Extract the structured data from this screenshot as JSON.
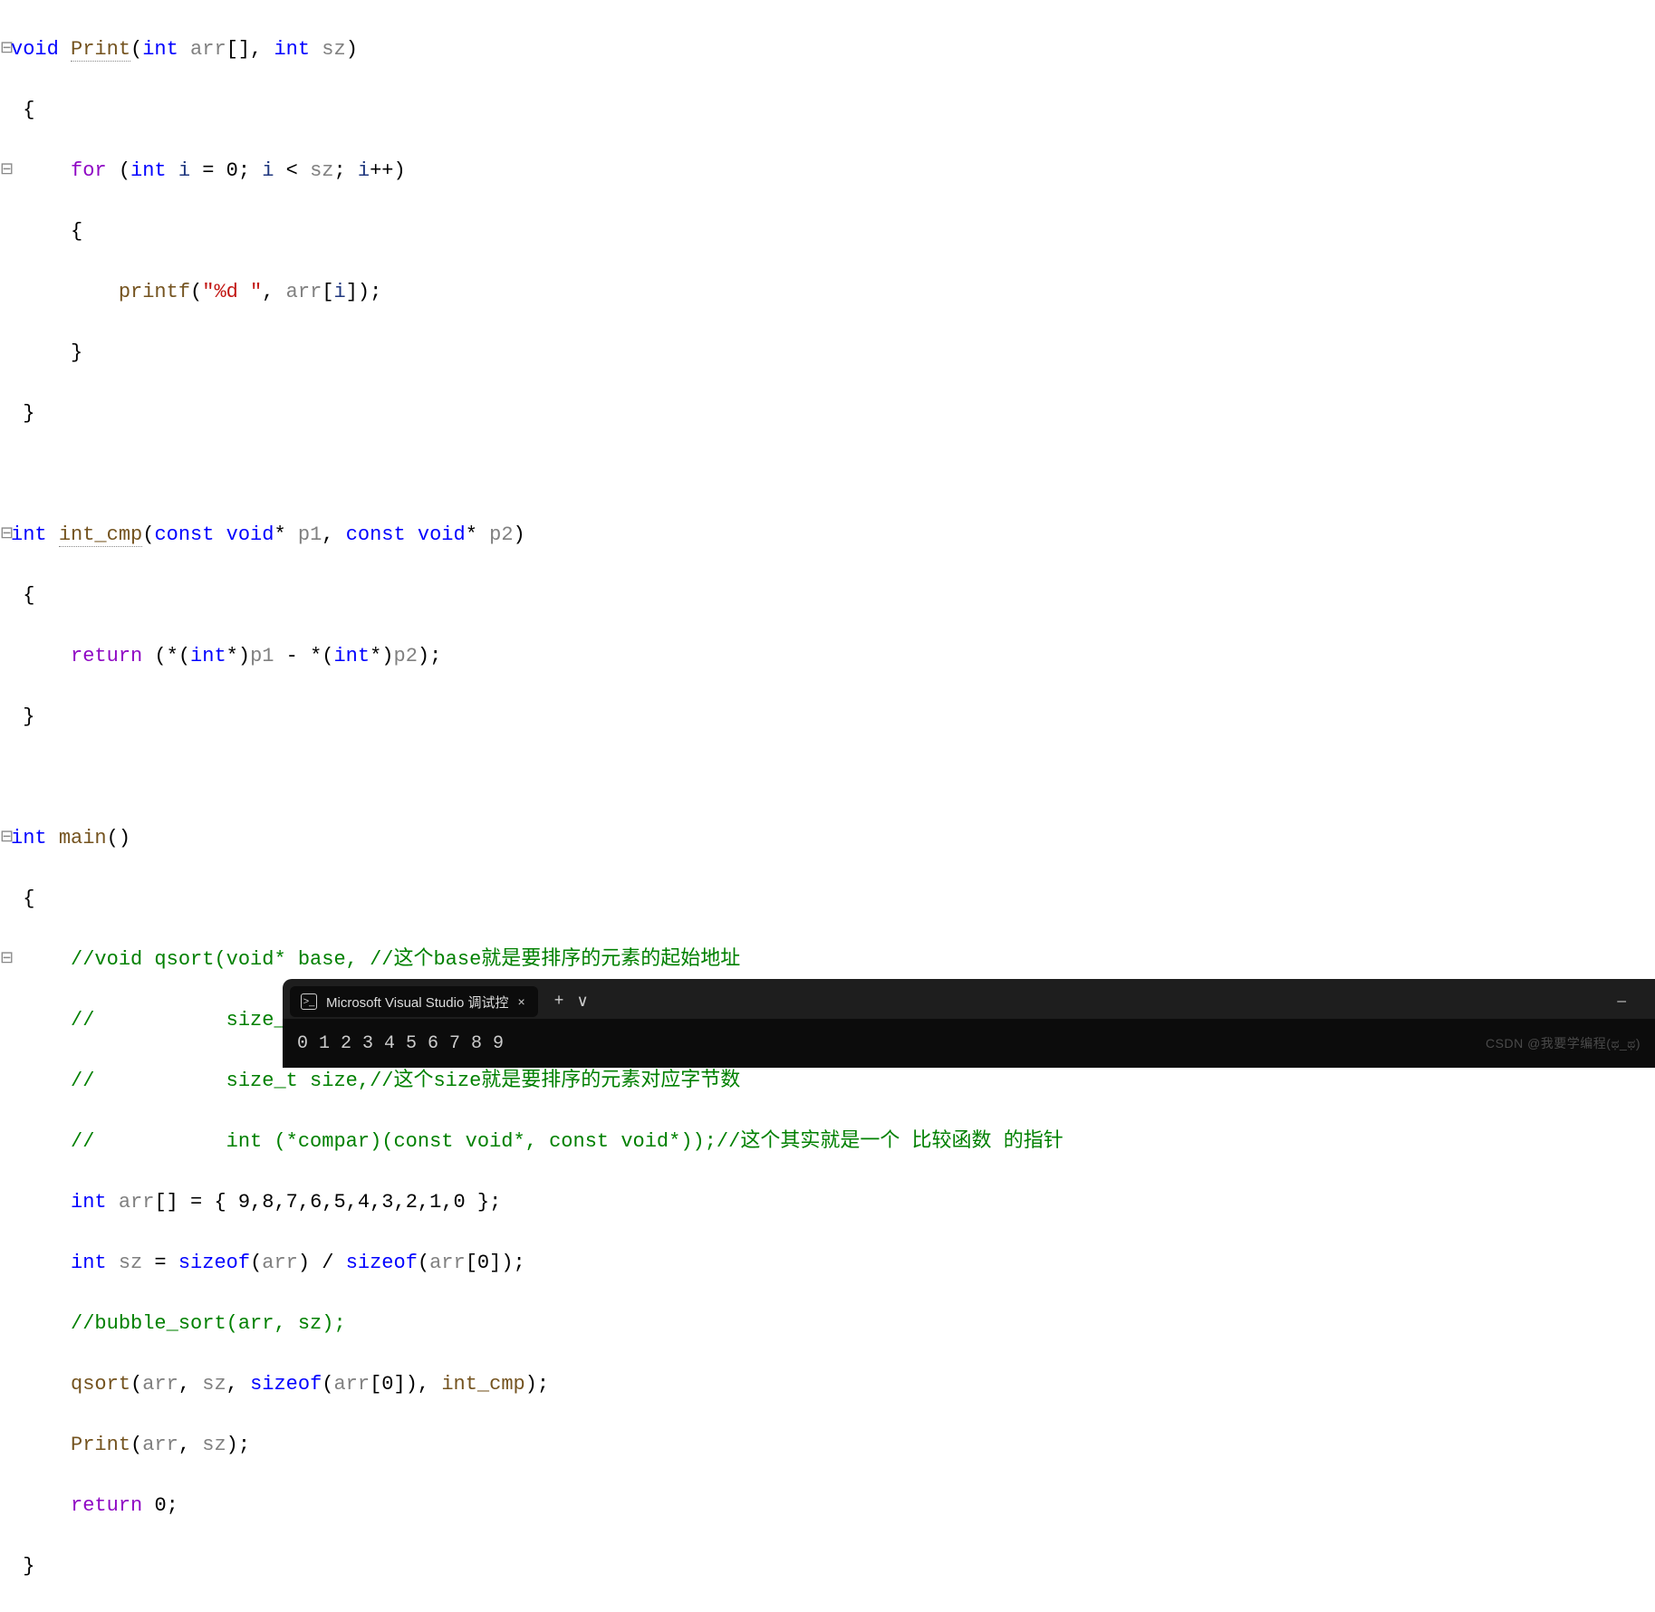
{
  "code": {
    "l1": {
      "void": "void",
      "print": "Print",
      "int": "int",
      "arr": "arr",
      "sz": "sz"
    },
    "l2": "{",
    "l3": {
      "for": "for",
      "int": "int",
      "i": "i",
      "eq": " = ",
      "zero": "0",
      "semi": "; ",
      "lt": " < ",
      "sz": "sz",
      "inc": "i++"
    },
    "l4": "{",
    "l5": {
      "printf": "printf",
      "fmt": "\"%d \"",
      "arr": "arr",
      "i": "i"
    },
    "l6": "}",
    "l7": "}",
    "l8": {
      "int": "int",
      "name": "int_cmp",
      "const": "const",
      "void": "void",
      "p1": "p1",
      "p2": "p2"
    },
    "l9": "{",
    "l10": {
      "return": "return",
      "int": "int",
      "p1": "p1",
      "p2": "p2"
    },
    "l11": "}",
    "l12": {
      "int": "int",
      "main": "main"
    },
    "l13": "{",
    "c1": "//void qsort(void* base, //这个base就是要排序的元素的起始地址",
    "c2": "//           size_t num, //这个num就是要排序的元素个数",
    "c3": "//           size_t size,//这个size就是要排序的元素对应字节数",
    "c4": "//           int (*compar)(const void*, const void*));//这个其实就是一个 比较函数 的指针",
    "l14": {
      "int": "int",
      "arr": "arr",
      "vals": "9,8,7,6,5,4,3,2,1,0"
    },
    "l15": {
      "int": "int",
      "sz": "sz",
      "sizeof": "sizeof",
      "arr": "arr",
      "zero": "0"
    },
    "c5": "//bubble_sort(arr, sz);",
    "l16": {
      "qsort": "qsort",
      "arr": "arr",
      "sz": "sz",
      "sizeof": "sizeof",
      "zero": "0",
      "cmp": "int_cmp"
    },
    "l17": {
      "print": "Print",
      "arr": "arr",
      "sz": "sz"
    },
    "l18": {
      "return": "return",
      "zero": "0"
    },
    "l19": "}"
  },
  "terminal": {
    "tab_icon_text": ">_",
    "tab_title": "Microsoft Visual Studio 调试控",
    "output": "0  1  2  3  4  5  6  7  8  9",
    "plus": "+",
    "chevron": "∨",
    "minimize": "—",
    "close": "×"
  },
  "watermark": "CSDN @我要学编程(ಥ_ಥ)"
}
